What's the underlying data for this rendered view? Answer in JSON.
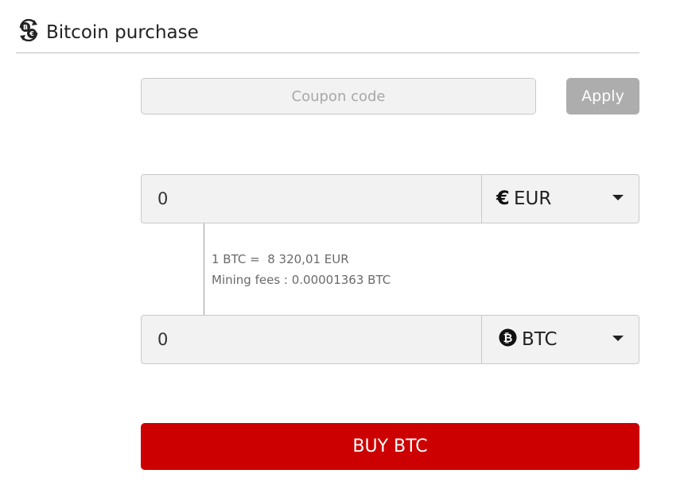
{
  "header": {
    "icon": "currency-exchange-icon",
    "title": "Bitcoin purchase"
  },
  "coupon": {
    "placeholder": "Coupon code",
    "value": "",
    "apply_label": "Apply"
  },
  "fiat": {
    "amount": "0",
    "currency_symbol": "€",
    "currency_code": "EUR",
    "icon": "euro-icon"
  },
  "crypto": {
    "amount": "0",
    "currency_code": "BTC",
    "icon": "bitcoin-icon"
  },
  "info": {
    "rate": "1 BTC =  8 320,01 EUR",
    "fees": "Mining fees : 0.00001363 BTC"
  },
  "buy": {
    "label": "BUY BTC"
  },
  "colors": {
    "accent": "#cc0000",
    "apply_button": "#adadad",
    "field_background": "#f2f2f2"
  }
}
